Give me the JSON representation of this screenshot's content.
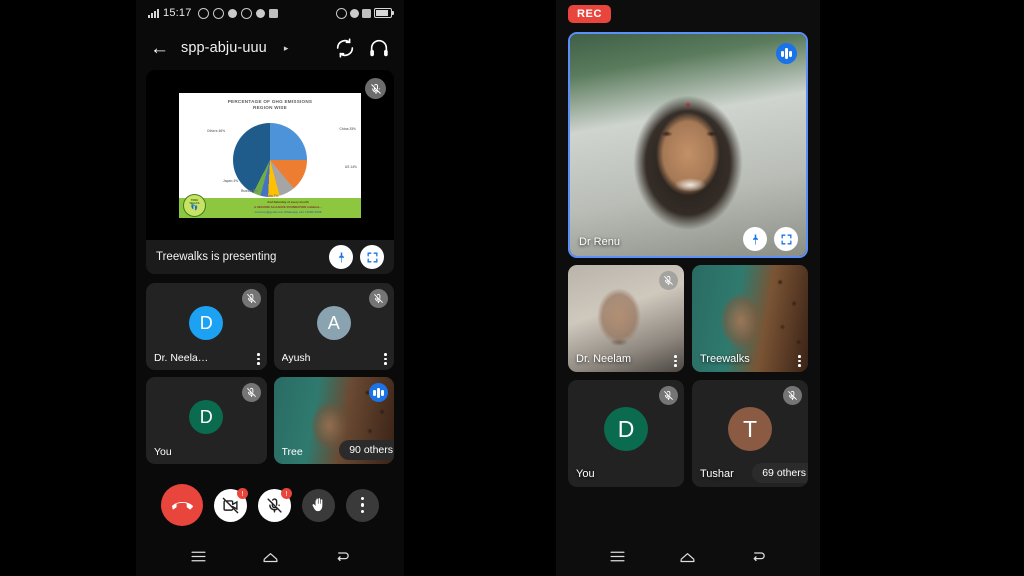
{
  "left_phone": {
    "status_bar": {
      "time": "15:17",
      "left_icons": [
        "signal-bars-icon",
        "sync-icon",
        "whatsapp-icon",
        "clock-icon",
        "updates-icon",
        "dot-icon",
        "message-icon"
      ],
      "right_icons": [
        "headphone-icon",
        "alarm-icon",
        "mobile-signal-icon",
        "battery-icon"
      ]
    },
    "header": {
      "back_label": "←",
      "meeting_title": "spp-abju-uuu",
      "caret": "▸",
      "right_icons": [
        "switch-camera-icon",
        "headphone-icon"
      ]
    },
    "presenting": {
      "status_text": "Treewalks is presenting",
      "pin_label": "pin-icon",
      "fullscreen_label": "fullscreen-icon",
      "mic_state": "muted",
      "slide": {
        "title_line1": "PERCENTAGE OF GHG EMISSIONS",
        "title_line2": "REGION WISE",
        "footer_line1": "2nd Saturday of every month",
        "footer_line2": "A SECOND ALLIANCE FOUNDATION initiative...",
        "footer_line3": "xxxxxxxx@gmail.com   WhatsApp +91 7439071508",
        "logo_line1": "TREE",
        "logo_line2": "WALKS"
      }
    },
    "tiles": [
      {
        "name": "Dr. Neela…",
        "avatar_letter": "D",
        "avatar_color": "#1da1f2",
        "mic": "muted",
        "type": "avatar"
      },
      {
        "name": "Ayush",
        "avatar_letter": "A",
        "avatar_color": "#8aa3b0",
        "mic": "muted",
        "type": "avatar"
      },
      {
        "name": "You",
        "avatar_letter": "D",
        "avatar_color": "#0b6b4f",
        "mic": "muted",
        "type": "avatar"
      },
      {
        "name": "Tree",
        "avatar_letter": "",
        "avatar_color": "",
        "mic": "active",
        "type": "video",
        "others_badge": "90 others"
      }
    ],
    "controls": [
      {
        "name": "end-call-button",
        "icon": "phone-hangup-icon",
        "style": "end",
        "badge": ""
      },
      {
        "name": "camera-button",
        "icon": "camera-off-icon",
        "style": "white",
        "badge": "!"
      },
      {
        "name": "microphone-button",
        "icon": "mic-off-icon",
        "style": "white",
        "badge": "!"
      },
      {
        "name": "raise-hand-button",
        "icon": "hand-icon",
        "style": "grey",
        "badge": ""
      },
      {
        "name": "more-options-button",
        "icon": "kebab-icon",
        "style": "grey",
        "badge": ""
      }
    ],
    "nav_bar": [
      "menu-icon",
      "home-icon",
      "back-icon"
    ]
  },
  "right_phone": {
    "rec_badge": "REC",
    "main_tile": {
      "name": "Dr Renu",
      "audio_state": "active",
      "pin_label": "pin-icon",
      "fullscreen_label": "fullscreen-icon"
    },
    "tiles": [
      {
        "name": "Dr. Neelam",
        "type": "video",
        "mic": "muted",
        "avatar_letter": "",
        "avatar_color": ""
      },
      {
        "name": "Treewalks",
        "type": "video",
        "mic": "none",
        "avatar_letter": "",
        "avatar_color": ""
      },
      {
        "name": "You",
        "type": "avatar",
        "mic": "muted",
        "avatar_letter": "D",
        "avatar_color": "#0b6b4f"
      },
      {
        "name": "Tushar",
        "type": "avatar",
        "mic": "muted",
        "avatar_letter": "T",
        "avatar_color": "#8a5a43",
        "others_badge": "69 others"
      }
    ],
    "nav_bar": [
      "menu-icon",
      "home-icon",
      "back-icon"
    ]
  },
  "chart_data": {
    "type": "pie",
    "title": "PERCENTAGE OF GHG EMISSIONS REGION WISE",
    "categories": [
      "China",
      "US",
      "India",
      "Russia",
      "Japan",
      "Others"
    ],
    "values": [
      25,
      14,
      7,
      5,
      3,
      46
    ],
    "labels": [
      "China 25%",
      "US 14%",
      "India 7%",
      "Russia 5%",
      "Japan 3%",
      "Others 46%"
    ],
    "colors": [
      "#4d93d9",
      "#ed7d31",
      "#a5a5a5",
      "#ffc000",
      "#4472c4",
      "#70ad47",
      "#1f5c8b"
    ],
    "legend": "none",
    "grid": false
  }
}
